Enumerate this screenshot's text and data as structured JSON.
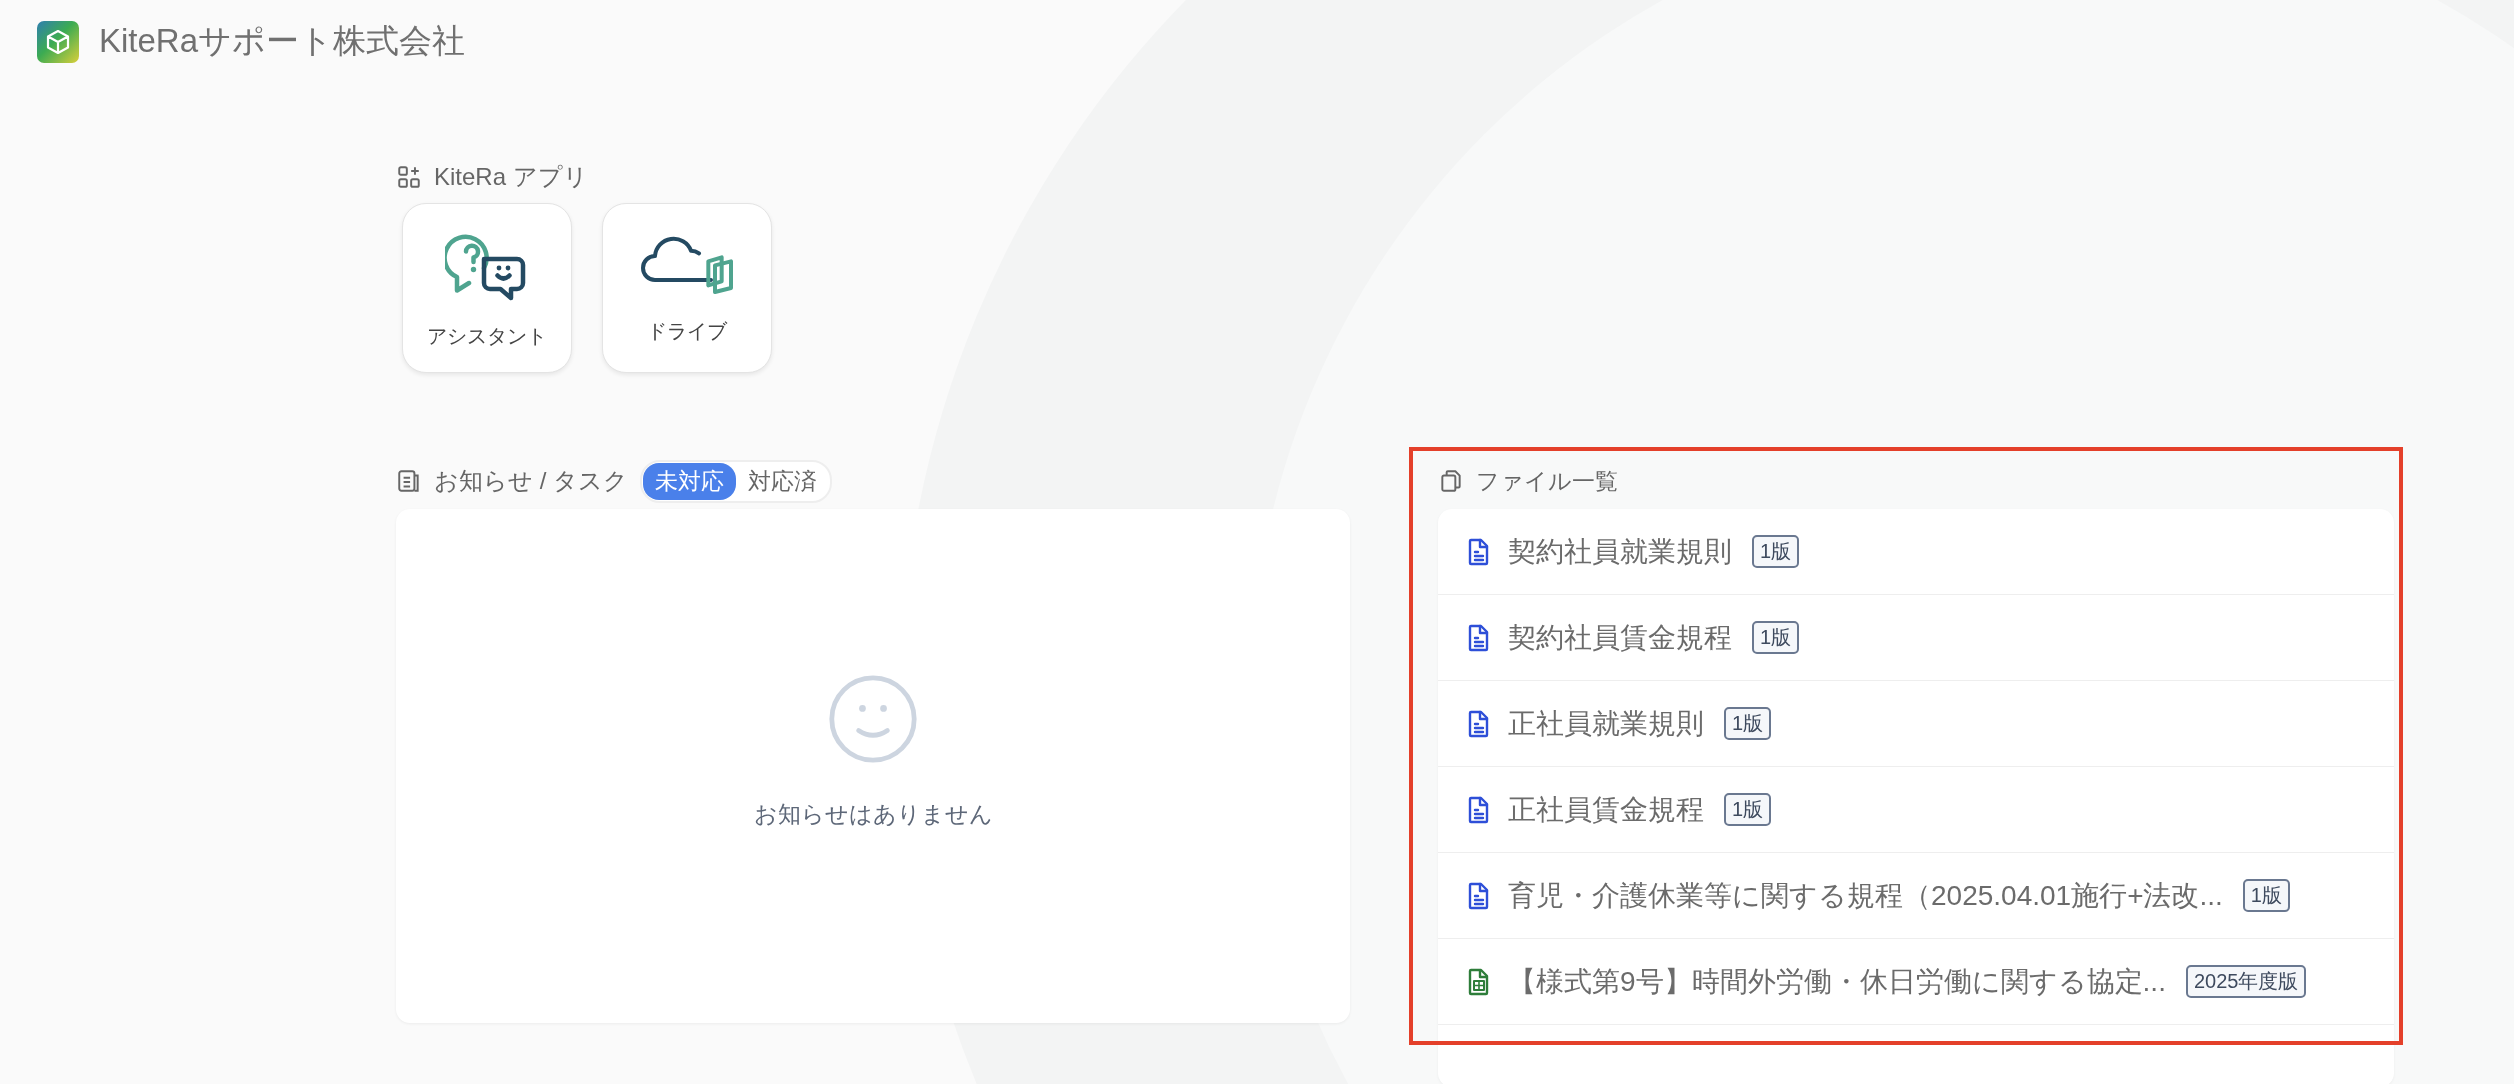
{
  "header": {
    "company": "KiteRaサポート株式会社"
  },
  "apps": {
    "label": "KiteRa アプリ",
    "items": [
      {
        "kind": "assistant",
        "label": "アシスタント"
      },
      {
        "kind": "drive",
        "label": "ドライブ"
      }
    ]
  },
  "notices": {
    "label": "お知らせ / タスク",
    "filters": [
      {
        "label": "未対応",
        "selected": true
      },
      {
        "label": "対応済",
        "selected": false
      }
    ],
    "empty_message": "お知らせはありません"
  },
  "files": {
    "label": "ファイル一覧",
    "items": [
      {
        "kind": "document",
        "name": "契約社員就業規則",
        "badge": "1版"
      },
      {
        "kind": "document",
        "name": "契約社員賃金規程",
        "badge": "1版"
      },
      {
        "kind": "document",
        "name": "正社員就業規則",
        "badge": "1版"
      },
      {
        "kind": "document",
        "name": "正社員賃金規程",
        "badge": "1版"
      },
      {
        "kind": "document",
        "name": "育児・介護休業等に関する規程（2025.04.01施行+法改...",
        "badge": "1版"
      },
      {
        "kind": "spreadsheet",
        "name": "【様式第9号】時間外労働・休日労働に関する協定...",
        "badge": "2025年度版"
      }
    ]
  }
}
